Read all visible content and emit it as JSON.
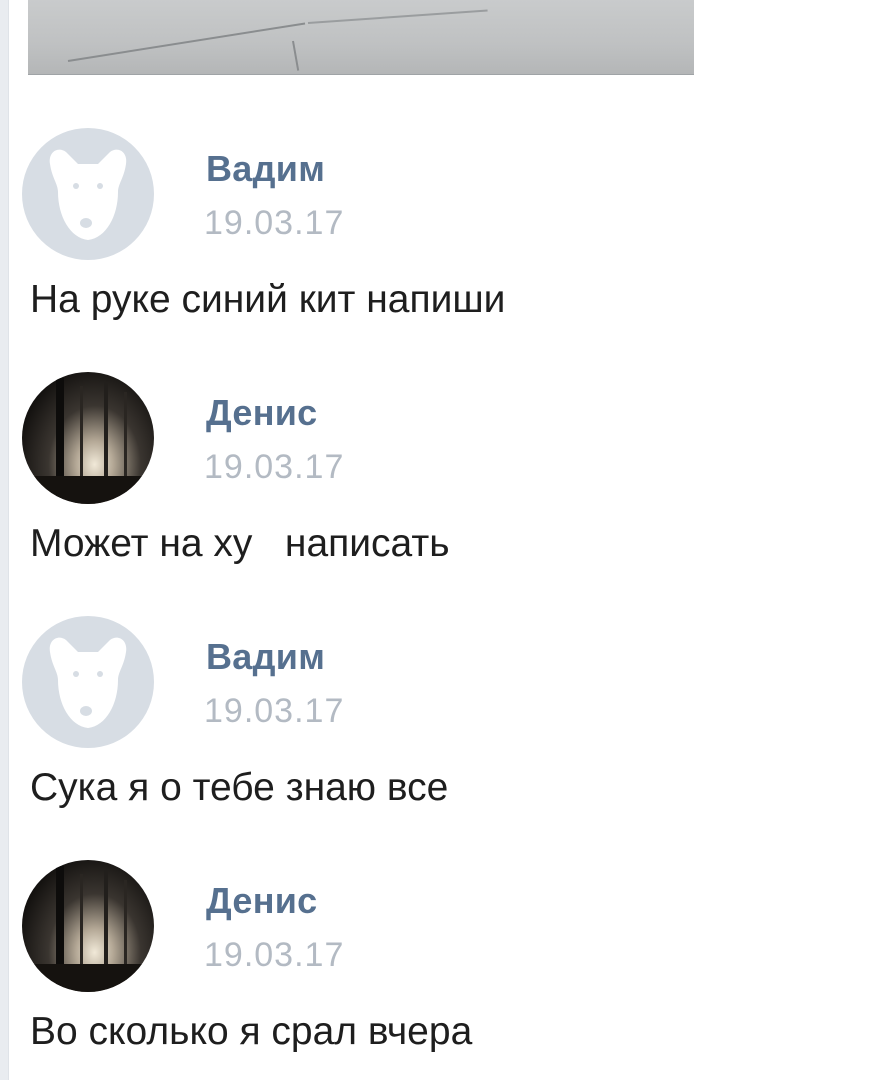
{
  "photo": {
    "alt_icon": "photo-attachment"
  },
  "messages": [
    {
      "author": "Вадим",
      "date": "19.03.17",
      "text": "На руке синий кит напиши",
      "avatar": "dog-placeholder-icon"
    },
    {
      "author": "Денис",
      "date": "19.03.17",
      "text": "Может на ху   написать",
      "avatar": "forest-photo"
    },
    {
      "author": "Вадим",
      "date": "19.03.17",
      "text": "Сука я о тебе знаю все",
      "avatar": "dog-placeholder-icon"
    },
    {
      "author": "Денис",
      "date": "19.03.17",
      "text": "Во сколько я срал вчера",
      "avatar": "forest-photo"
    }
  ],
  "colors": {
    "author": "#56708f",
    "timestamp": "#b3bac3",
    "text": "#1e1e1e",
    "placeholder_avatar": "#d7dde4"
  }
}
